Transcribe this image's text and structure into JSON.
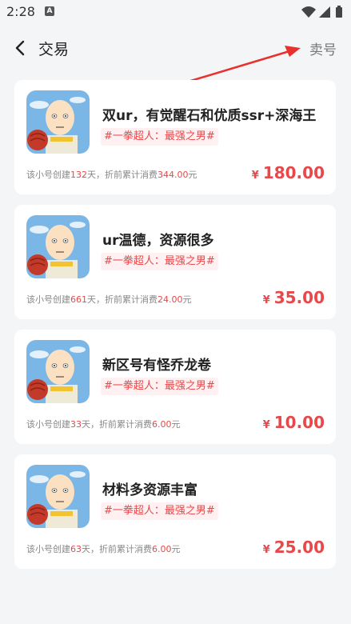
{
  "status_bar": {
    "time": "2:28",
    "notification_badge": "A"
  },
  "nav": {
    "title": "交易",
    "sell_label": "卖号"
  },
  "listings": [
    {
      "title": "双ur，有觉醒石和优质ssr+深海王",
      "tag": "#一拳超人：最强之男#",
      "meta_prefix": "该小号创建",
      "days": "132",
      "meta_mid": "天，折前累计消费",
      "spent": "344.00",
      "meta_suffix": "元",
      "currency": "¥",
      "price": "180.00"
    },
    {
      "title": "ur温德，资源很多",
      "tag": "#一拳超人：最强之男#",
      "meta_prefix": "该小号创建",
      "days": "661",
      "meta_mid": "天，折前累计消费",
      "spent": "24.00",
      "meta_suffix": "元",
      "currency": "¥",
      "price": "35.00"
    },
    {
      "title": "新区号有怪乔龙卷",
      "tag": "#一拳超人：最强之男#",
      "meta_prefix": "该小号创建",
      "days": "33",
      "meta_mid": "天，折前累计消费",
      "spent": "6.00",
      "meta_suffix": "元",
      "currency": "¥",
      "price": "10.00"
    },
    {
      "title": "材料多资源丰富",
      "tag": "#一拳超人：最强之男#",
      "meta_prefix": "该小号创建",
      "days": "63",
      "meta_mid": "天，折前累计消费",
      "spent": "6.00",
      "meta_suffix": "元",
      "currency": "¥",
      "price": "25.00"
    }
  ],
  "colors": {
    "accent": "#e8484a",
    "background": "#f4f5f7",
    "card": "#ffffff",
    "annotation_arrow": "#e8302c"
  },
  "icons": {
    "back": "chevron-left-icon",
    "wifi": "wifi-icon",
    "signal": "signal-icon",
    "battery": "battery-icon",
    "game": "one-punch-man-game-icon"
  }
}
